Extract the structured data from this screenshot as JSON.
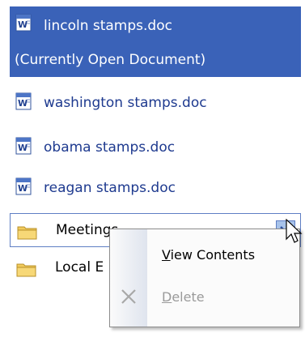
{
  "selected_file": {
    "name": "lincoln stamps.doc",
    "subtitle": "(Currently Open Document)"
  },
  "files": [
    {
      "name": "washington stamps.doc",
      "icon": "word-document-icon"
    },
    {
      "name": "obama stamps.doc",
      "icon": "word-document-icon"
    },
    {
      "name": "reagan stamps.doc",
      "icon": "word-document-icon"
    }
  ],
  "folders": [
    {
      "name": "Meetings",
      "icon": "folder-icon"
    },
    {
      "name": "Local E",
      "icon": "folder-icon"
    }
  ],
  "context_menu": {
    "items": [
      {
        "label": "View Contents",
        "accesskey": "V",
        "enabled": true
      },
      {
        "label": "Delete",
        "accesskey": "D",
        "enabled": false,
        "icon": "delete-x-icon"
      }
    ]
  },
  "colors": {
    "selection": "#3a62b8",
    "link_text": "#1e3a8f",
    "hover_border": "#5f7fc4",
    "dropdown_bg": "#a8c3ea",
    "disabled_text": "#9a9a9a"
  }
}
